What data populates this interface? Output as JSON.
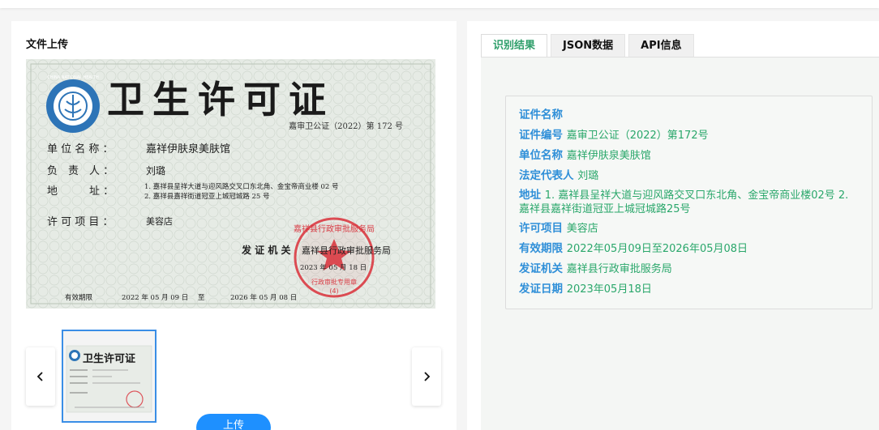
{
  "upload": {
    "title": "文件上传",
    "upload_button": "上传"
  },
  "certificate": {
    "emblem_text": "CHINA NATIONAL HEALTH",
    "heading": "卫生许可证",
    "number_line": "嘉审卫公证（2022）第 172 号",
    "unit_label": "单 位 名 称 ：",
    "unit_value": "嘉祥伊肤泉美肤馆",
    "person_label": "负　责　人 ：",
    "person_value": "刘璐",
    "address_label": "地　　　址 ：",
    "address_line1": "1. 嘉祥县呈祥大道与迎风路交叉口东北角、金宝帝商业楼 02 号",
    "address_line2": "2. 嘉祥县嘉祥街道冠亚上城冠城路 25 号",
    "item_label": "许 可 项 目 ：",
    "item_value": "美容店",
    "issuer_label": "发 证 机 关",
    "issuer_value": "嘉祥县行政审批服务局",
    "issue_date": "2023 年 05 月 18 日",
    "seal_text": "嘉祥县行政审批服务局",
    "seal_sub": "行政审批专用章",
    "seal_num": "(4)",
    "valid_label": "有效期限",
    "valid_from": "2022 年 05 月 09 日",
    "valid_to_word": "至",
    "valid_to": "2026 年 05 月 08 日"
  },
  "thumbnail": {
    "heading": "卫生许可证"
  },
  "tabs": [
    {
      "label": "识别结果",
      "active": true
    },
    {
      "label": "JSON数据",
      "active": false
    },
    {
      "label": "API信息",
      "active": false
    }
  ],
  "result": {
    "fields": [
      {
        "label": "证件名称",
        "value": ""
      },
      {
        "label": "证件编号",
        "value": "嘉审卫公证（2022）第172号"
      },
      {
        "label": "单位名称",
        "value": "嘉祥伊肤泉美肤馆"
      },
      {
        "label": "法定代表人",
        "value": "刘璐"
      },
      {
        "label": "地址",
        "value": "1. 嘉祥县呈祥大道与迎风路交叉口东北角、金宝帝商业楼02号 2. 嘉祥县嘉祥街道冠亚上城冠城路25号"
      },
      {
        "label": "许可项目",
        "value": "美容店"
      },
      {
        "label": "有效期限",
        "value": "2022年05月09日至2026年05月08日"
      },
      {
        "label": "发证机关",
        "value": "嘉祥县行政审批服务局"
      },
      {
        "label": "发证日期",
        "value": "2023年05月18日"
      }
    ]
  },
  "colors": {
    "accent_green": "#2aa76b",
    "label_blue": "#2f8fd8",
    "button_blue": "#1e90ff",
    "seal_red": "#d9303a"
  },
  "icons": {
    "prev": "chevron-left-icon",
    "next": "chevron-right-icon",
    "emblem": "health-emblem-icon"
  }
}
